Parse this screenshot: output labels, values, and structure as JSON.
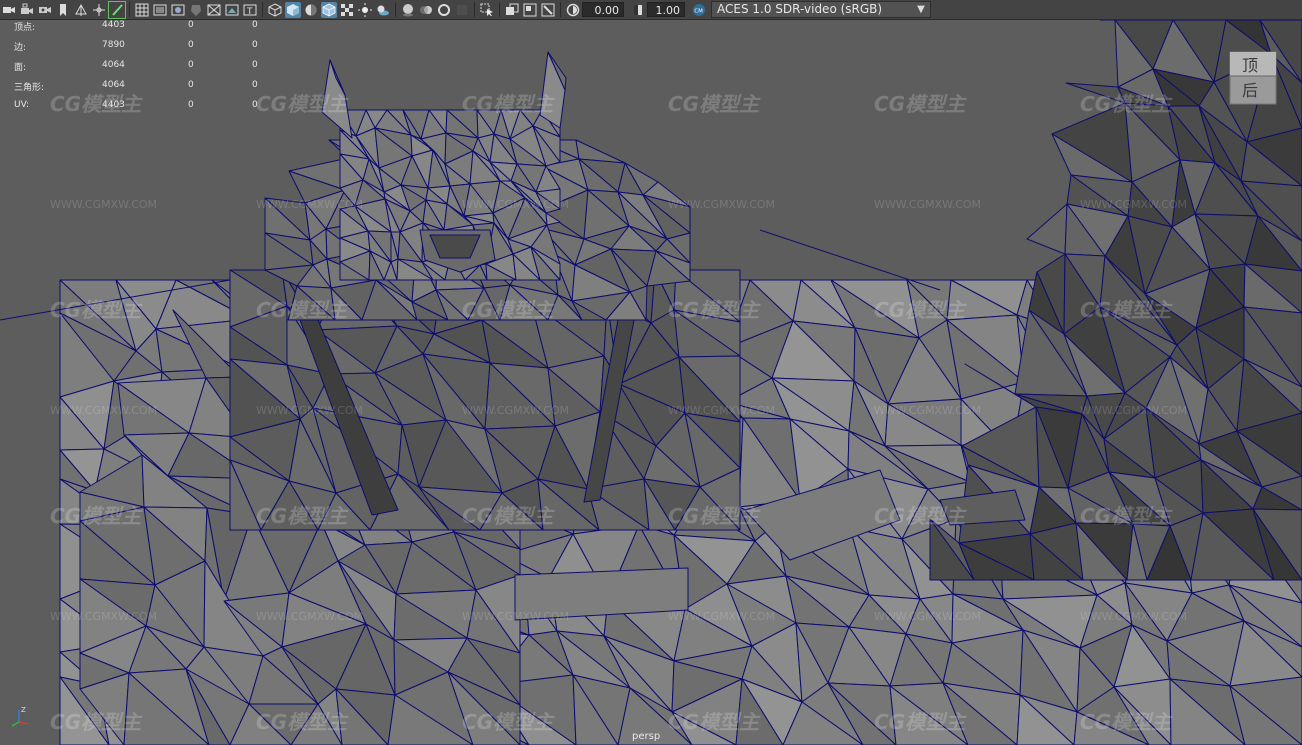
{
  "toolbar": {
    "icons": [
      "camera-select-icon",
      "camera-lock-icon",
      "camera-attributes-icon",
      "bookmark-icon",
      "image-plane-icon",
      "2d-pan-zoom-icon",
      "grease-pencil-icon",
      "grid-icon",
      "film-gate-icon",
      "resolution-gate-icon",
      "gate-mask-icon",
      "field-chart-icon",
      "safe-action-icon",
      "safe-title-icon",
      "wireframe-icon",
      "smooth-shade-icon",
      "default-material-icon",
      "wireframe-on-shaded-icon",
      "textured-icon",
      "use-all-lights-icon",
      "shadows-icon",
      "screen-space-ao-icon",
      "motion-blur-icon",
      "multisample-aa-icon",
      "depth-of-field-icon",
      "isolate-select-icon",
      "xray-icon",
      "xray-active-components-icon",
      "xray-joints-icon",
      "exposure-icon",
      "gamma-icon",
      "color-management-icon"
    ],
    "exposure_value": "0.00",
    "gamma_value": "1.00",
    "view_transform": "ACES 1.0 SDR-video (sRGB)"
  },
  "hud": {
    "rows": [
      {
        "label": "顶点:",
        "v1": "4403",
        "v2": "0",
        "v3": "0"
      },
      {
        "label": "边:",
        "v1": "7890",
        "v2": "0",
        "v3": "0"
      },
      {
        "label": "面:",
        "v1": "4064",
        "v2": "0",
        "v3": "0"
      },
      {
        "label": "三角形:",
        "v1": "4064",
        "v2": "0",
        "v3": "0"
      },
      {
        "label": "UV:",
        "v1": "4403",
        "v2": "0",
        "v3": "0"
      }
    ]
  },
  "viewcube": {
    "top_label": "顶",
    "back_label": "后"
  },
  "camera_label": "persp",
  "watermark": {
    "logo": "CG模型主",
    "url": "WWW.CGMXW.COM"
  },
  "colors": {
    "toolbar_bg": "#444444",
    "viewport_bg": "#5d5d5d",
    "wire": "#0d0d6e",
    "active_icon": "#5285a6"
  }
}
